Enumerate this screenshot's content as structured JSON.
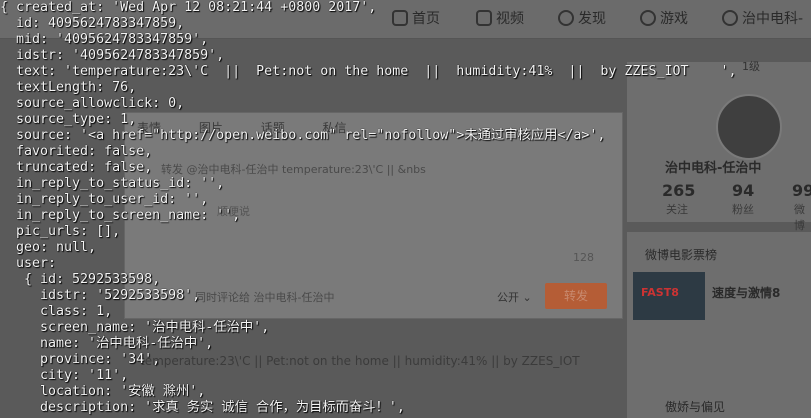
{
  "background_page": {
    "nav": {
      "home_label": "首页",
      "video_label": "视频",
      "discover_label": "发现",
      "game_label": "游戏",
      "user_label": "治中电科-"
    },
    "dialog": {
      "tabs": [
        "表情",
        "图片",
        "话题",
        "私信"
      ],
      "forward_text": "转发 @治中电科-任治中 temperature:23\\'C || &nbs",
      "placeholder": "顺便说",
      "counter": "128",
      "also_comment": "同时评论给 治中电科-任治中",
      "visibility": "公开",
      "send_label": "转发"
    },
    "post_snippet": "temperature:23\\'C || Pet:not on the home || humidity:41% || by ZZES_IOT",
    "sidebar": {
      "top_right_label": "1级",
      "profile_name": "治中电科-任治中",
      "stats": [
        {
          "value": "265",
          "label": "关注"
        },
        {
          "value": "94",
          "label": "粉丝"
        },
        {
          "value": "99",
          "label": "微博"
        }
      ],
      "movie_section_title": "微博电影票榜",
      "movie_poster_label": "FAST8",
      "movie_name": "速度与激情8",
      "next_item": "傲娇与偏见"
    }
  },
  "console_lines": [
    "{ created_at: 'Wed Apr 12 08:21:44 +0800 2017',",
    "  id: 4095624783347859,",
    "  mid: '4095624783347859',",
    "  idstr: '4095624783347859',",
    "  text: 'temperature:23\\'C  ||  Pet:not on the home  ||  humidity:41%  ||  by ZZES_IOT    ',",
    "  textLength: 76,",
    "  source_allowclick: 0,",
    "  source_type: 1,",
    "  source: '<a href=\"http://open.weibo.com\" rel=\"nofollow\">未通过审核应用</a>',",
    "  favorited: false,",
    "  truncated: false,",
    "  in_reply_to_status_id: '',",
    "  in_reply_to_user_id: '',",
    "  in_reply_to_screen_name: '',",
    "  pic_urls: [],",
    "  geo: null,",
    "  user:",
    "   { id: 5292533598,",
    "     idstr: '5292533598',",
    "     class: 1,",
    "     screen_name: '治中电科-任治中',",
    "     name: '治中电科-任治中',",
    "     province: '34',",
    "     city: '11',",
    "     location: '安徽 滁州',",
    "     description: '求真 务实 诚信 合作，为目标而奋斗！',"
  ]
}
